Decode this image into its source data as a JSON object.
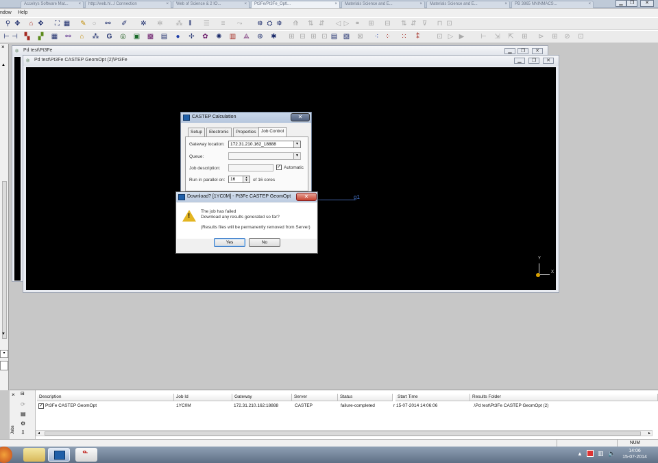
{
  "browser_tabs": [
    "Accelrys Software Mat...",
    "http://web.hl...l Connection",
    "Web of Science & 2 IO...",
    "Pt3Fe/Pt3Fe_Optl...",
    "Materials Science and E...",
    "Materials Science and E...",
    "PB 3865 NNINMACS..."
  ],
  "menu": [
    "ndow",
    "Help"
  ],
  "child_window": {
    "title": "Pd test\\Pt3Fe"
  },
  "viewer_window": {
    "title": "Pd test\\Pt3Fe CASTEP GeomOpt (2)\\Pt3Fe",
    "atom_label": "g1",
    "axis_y": "Y",
    "axis_x": "X"
  },
  "castep_dialog": {
    "title": "CASTEP Calculation",
    "close_glyph": "✕",
    "tabs": [
      "Setup",
      "Electronic",
      "Properties",
      "Job Control"
    ],
    "gateway_label": "Gateway location:",
    "gateway_value": "172.31.210.162_18888",
    "queue_label": "Queue:",
    "jobdesc_label": "Job description:",
    "automatic_label": "Automatic",
    "parallel_label": "Run in parallel on:",
    "parallel_value": "16",
    "parallel_of": "of  16  cores"
  },
  "download_dialog": {
    "title": "Download? [1YC0M] - Pt3Fe CASTEP GeomOpt",
    "line1": "The job has failed",
    "line2": "Download any results generated so far?",
    "line3": "(Results files will be permanently removed from Server)",
    "yes": "Yes",
    "no": "No"
  },
  "jobs": {
    "side_label": "Jobs",
    "columns": [
      "Description",
      "Job Id",
      "Gateway",
      "Server",
      "Status",
      "Start Time",
      "Results Folder"
    ],
    "rows": [
      {
        "description": "Pt3Fe CASTEP GeomOpt",
        "job_id": "1YC0M",
        "gateway": "172.31.210.162:18888",
        "server": "CASTEP",
        "status": "failure-completed",
        "start_time": "r  15-07-2014 14:06:06",
        "results_folder": ".\\Pd test\\Pt3Fe CASTEP GeomOpt (2)"
      }
    ]
  },
  "statusbar": {
    "num": "NUM"
  },
  "clock": {
    "time": "14:06",
    "date": "15-07-2014"
  }
}
